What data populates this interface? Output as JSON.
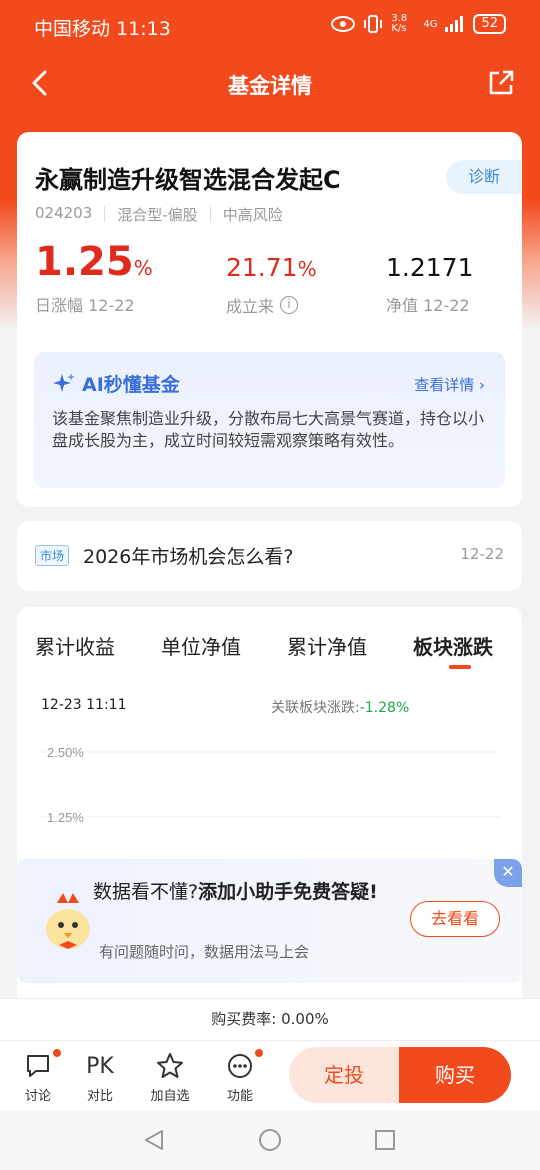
{
  "status_bar": {
    "carrier": "中国移动",
    "time": "11:13",
    "net_speed": "3.8 K/s",
    "signal": "4G",
    "battery": "52"
  },
  "nav": {
    "title": "基金详情"
  },
  "fund": {
    "name": "永赢制造升级智选混合发起C",
    "diagnose_label": "诊断",
    "code": "024203",
    "type": "混合型-偏股",
    "risk": "中高风险",
    "day_change_value": "1.25",
    "day_change_unit": "%",
    "day_change_label": "日涨幅 12-22",
    "since_inception_value": "21.71",
    "since_inception_unit": "%",
    "since_inception_label": "成立来",
    "nav_value": "1.2171",
    "nav_label": "净值 12-22"
  },
  "ai": {
    "title": "AI秒懂基金",
    "link": "查看详情",
    "text": "该基金聚焦制造业升级，分散布局七大高景气赛道，持仓以小盘成长股为主，成立时间较短需观察策略有效性。"
  },
  "news": {
    "tag": "市场",
    "title": "2026年市场机会怎么看?",
    "date": "12-22"
  },
  "chart": {
    "tabs": [
      "累计收益",
      "单位净值",
      "累计净值",
      "板块涨跌"
    ],
    "active_tab": 3,
    "time": "12-23 11:11",
    "sector_label": "关联板块涨跌:",
    "sector_value": "-1.28%"
  },
  "chart_data": {
    "type": "line",
    "title": "",
    "xlabel": "",
    "ylabel": "",
    "y_ticks": [
      "2.50%",
      "1.25%"
    ],
    "series": []
  },
  "helper": {
    "title_normal": "数据看不懂?",
    "title_bold": "添加小助手免费答疑!",
    "subtitle": "有问题随时问，数据用法马上会",
    "button": "去看看"
  },
  "fee": {
    "label": "购买费率:",
    "value": "0.00%"
  },
  "actions": {
    "discuss": "讨论",
    "compare_icon": "PK",
    "compare": "对比",
    "watch": "加自选",
    "functions": "功能",
    "sip": "定投",
    "buy": "购买"
  },
  "colors": {
    "brand": "#f24a1d",
    "up": "#e02b1c",
    "down": "#1fa84b",
    "ai_blue": "#3a6fd8"
  }
}
